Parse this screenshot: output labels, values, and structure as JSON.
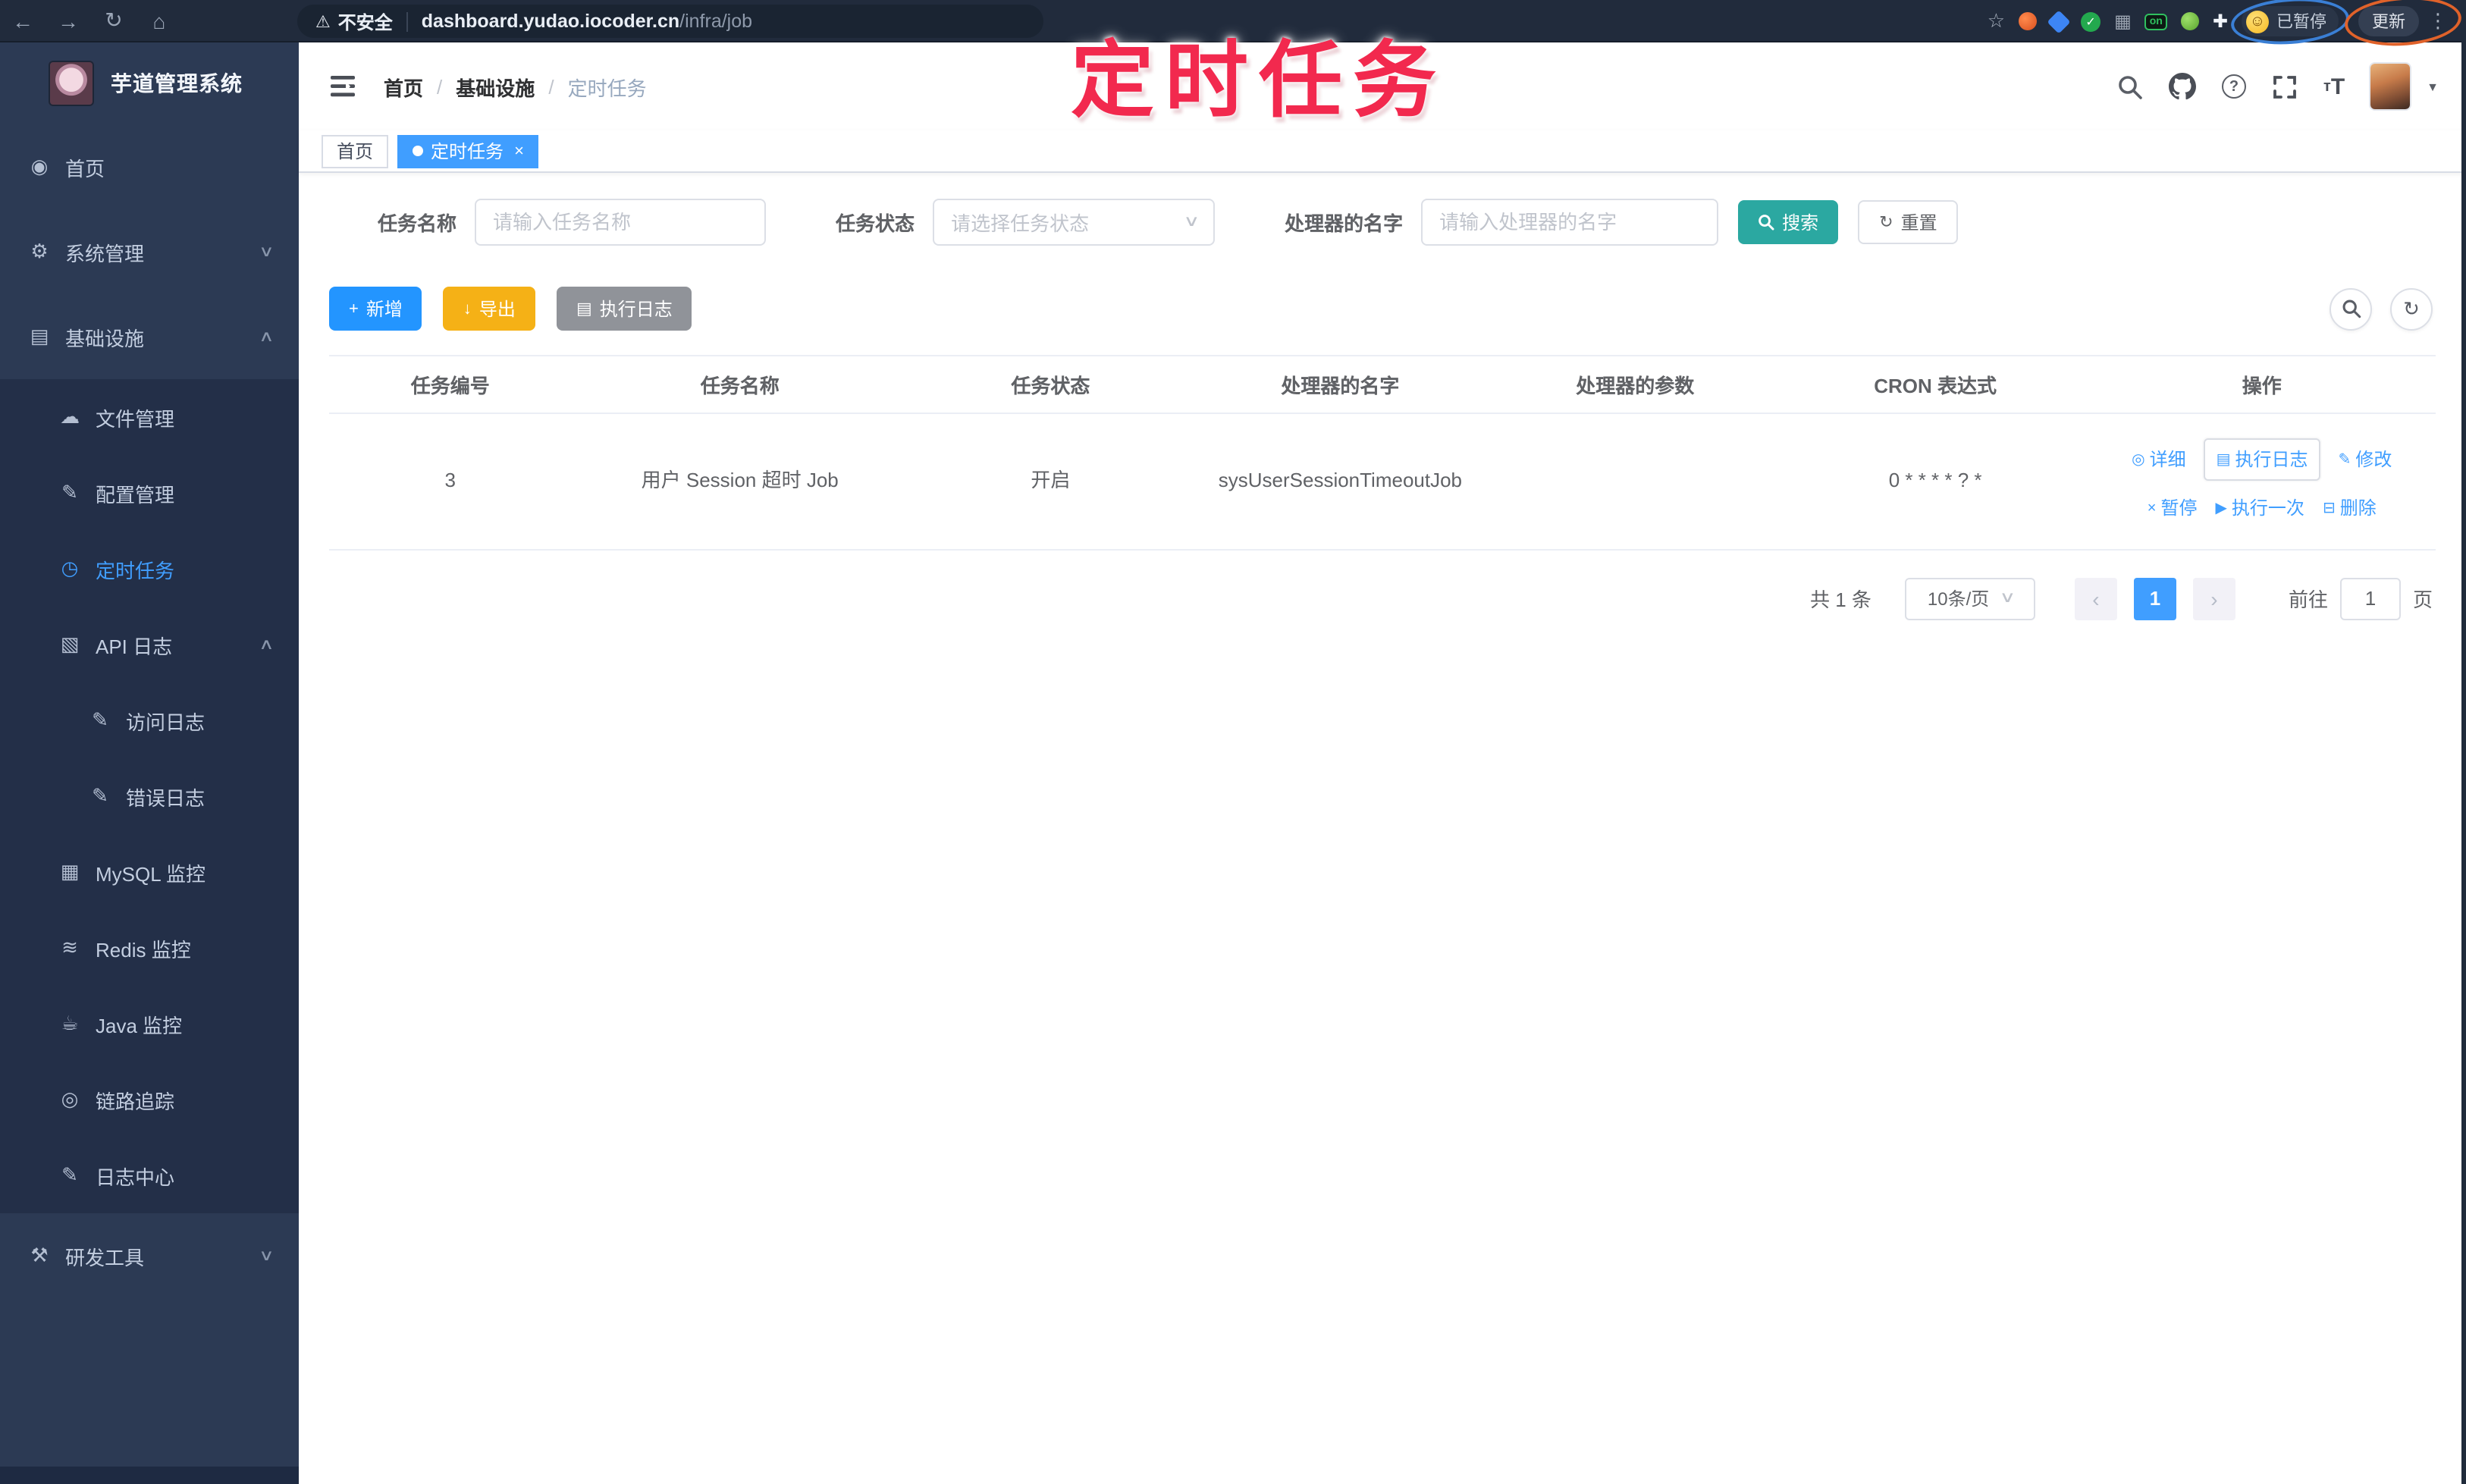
{
  "browser": {
    "security_label": "不安全",
    "url_host": "dashboard.yudao.iocoder.cn",
    "url_path": "/infra/job",
    "on_badge": "on",
    "paused_label": "已暂停",
    "update_label": "更新"
  },
  "annotation": {
    "title": "定时任务"
  },
  "sidebar": {
    "logo_title": "芋道管理系统",
    "items": [
      {
        "label": "首页"
      },
      {
        "label": "系统管理"
      },
      {
        "label": "基础设施"
      },
      {
        "label": "文件管理"
      },
      {
        "label": "配置管理"
      },
      {
        "label": "定时任务"
      },
      {
        "label": "API 日志"
      },
      {
        "label": "访问日志"
      },
      {
        "label": "错误日志"
      },
      {
        "label": "MySQL 监控"
      },
      {
        "label": "Redis 监控"
      },
      {
        "label": "Java 监控"
      },
      {
        "label": "链路追踪"
      },
      {
        "label": "日志中心"
      },
      {
        "label": "研发工具"
      }
    ]
  },
  "header": {
    "breadcrumb": [
      "首页",
      "基础设施",
      "定时任务"
    ],
    "sep": "/"
  },
  "tags": {
    "home": "首页",
    "active": "定时任务"
  },
  "filters": {
    "name_label": "任务名称",
    "name_placeholder": "请输入任务名称",
    "status_label": "任务状态",
    "status_placeholder": "请选择任务状态",
    "handler_label": "处理器的名字",
    "handler_placeholder": "请输入处理器的名字",
    "search_label": "搜索",
    "reset_label": "重置"
  },
  "toolbar": {
    "add_label": "新增",
    "export_label": "导出",
    "exec_log_label": "执行日志"
  },
  "table": {
    "headers": [
      "任务编号",
      "任务名称",
      "任务状态",
      "处理器的名字",
      "处理器的参数",
      "CRON 表达式",
      "操作"
    ],
    "row": {
      "id": "3",
      "name": "用户 Session 超时 Job",
      "status": "开启",
      "handler": "sysUserSessionTimeoutJob",
      "param": "",
      "cron": "0 * * * * ? *"
    },
    "actions": {
      "detail": "详细",
      "exec_log": "执行日志",
      "edit": "修改",
      "pause": "暂停",
      "run_once": "执行一次",
      "delete": "删除"
    }
  },
  "pagination": {
    "total": "共 1 条",
    "page_size": "10条/页",
    "page": "1",
    "goto": "前往",
    "goto_value": "1",
    "unit": "页"
  },
  "icons": {
    "back": "←",
    "forward": "→",
    "reload": "↻",
    "home": "⌂",
    "warning": "⚠",
    "star": "☆",
    "grid": "▦",
    "puzzle": "✚",
    "smiley": "☺",
    "menu_dots": "⋮",
    "check": "✓",
    "chevron_down": "∨",
    "chevron_up": "∧",
    "caret_down": "▼",
    "dashboard": "◉",
    "gear": "⚙",
    "infra": "▤",
    "cloud": "☁",
    "edit": "✎",
    "timer": "◷",
    "api_log": "▧",
    "doc": "✎",
    "mysql": "▦",
    "redis": "≋",
    "java": "☕",
    "trace": "◎",
    "log_center": "✎",
    "tools": "⚒",
    "plus": "+",
    "download": "↓",
    "list": "▤",
    "refresh": "↻",
    "eye": "◎",
    "close": "×",
    "play": "▶",
    "trash": "⊟"
  }
}
